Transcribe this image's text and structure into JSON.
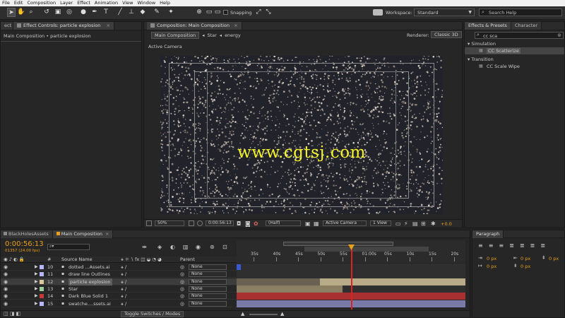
{
  "menu": [
    "File",
    "Edit",
    "Composition",
    "Layer",
    "Effect",
    "Animation",
    "View",
    "Window",
    "Help"
  ],
  "toolbar": {
    "snapping_label": "Snapping",
    "workspace_label": "Workspace:",
    "workspace_value": "Standard",
    "search_help_placeholder": "Search Help"
  },
  "left_panel": {
    "tab_prev": "ect",
    "tab_active": "Effect Controls: particle explosion",
    "breadcrumb": "Main Composition • particle explosion"
  },
  "comp_panel": {
    "tab_label": "Composition: Main Composition",
    "nav": [
      "Main Composition",
      "Star",
      "energy"
    ],
    "renderer_label": "Renderer:",
    "renderer_value": "Classic 3D",
    "view_label": "Active Camera",
    "watermark": "www.cgtsj.com",
    "zoom": "50%",
    "timecode": "0:00:56:13",
    "resolution": "(Half)",
    "camera": "Active Camera",
    "view_count": "1 View",
    "exposure": "+0.0"
  },
  "effects_panel": {
    "tabs": [
      "Effects & Presets",
      "Character"
    ],
    "search_value": "cc sca",
    "categories": [
      {
        "name": "Simulation",
        "items": [
          "CC Scatterize"
        ]
      },
      {
        "name": "Transition",
        "items": [
          "CC Scale Wipe"
        ]
      }
    ]
  },
  "paragraph_panel": {
    "tab": "Paragraph",
    "fields": [
      "0 px",
      "0 px",
      "0 px",
      "0 px",
      "0 px"
    ]
  },
  "timeline": {
    "tabs": [
      "BlackHolesAssets",
      "Main Composition"
    ],
    "current_time": "0:00:56:13",
    "frames": "01357 (24.00 fps)",
    "header_num": "#",
    "header_source": "Source Name",
    "header_parent": "Parent",
    "ruler_labels": [
      "35s",
      "40s",
      "45s",
      "50s",
      "55s",
      "01:00s",
      "05s",
      "10s",
      "15s",
      "20s"
    ],
    "toggle_label": "Toggle Switches / Modes",
    "layers": [
      {
        "num": "10",
        "name": "dotted ...Assets.ai",
        "color": "#b6b6ff",
        "parent": "None"
      },
      {
        "num": "11",
        "name": "draw line Outlines",
        "color": "#b6b6ff",
        "parent": "None"
      },
      {
        "num": "12",
        "name": "particle explosion",
        "color": "#d8c89a",
        "parent": "None"
      },
      {
        "num": "13",
        "name": "Star",
        "color": "#9ccc9c",
        "parent": "None"
      },
      {
        "num": "14",
        "name": "Dark Blue Solid 1",
        "color": "#c43a3a",
        "parent": "None"
      },
      {
        "num": "15",
        "name": "swatche....ssets.ai",
        "color": "#b6b6ff",
        "parent": "None"
      }
    ]
  },
  "colors": {
    "accent_orange": "#e6a019",
    "watermark": "#f5f52a",
    "playhead": "#e02020"
  }
}
